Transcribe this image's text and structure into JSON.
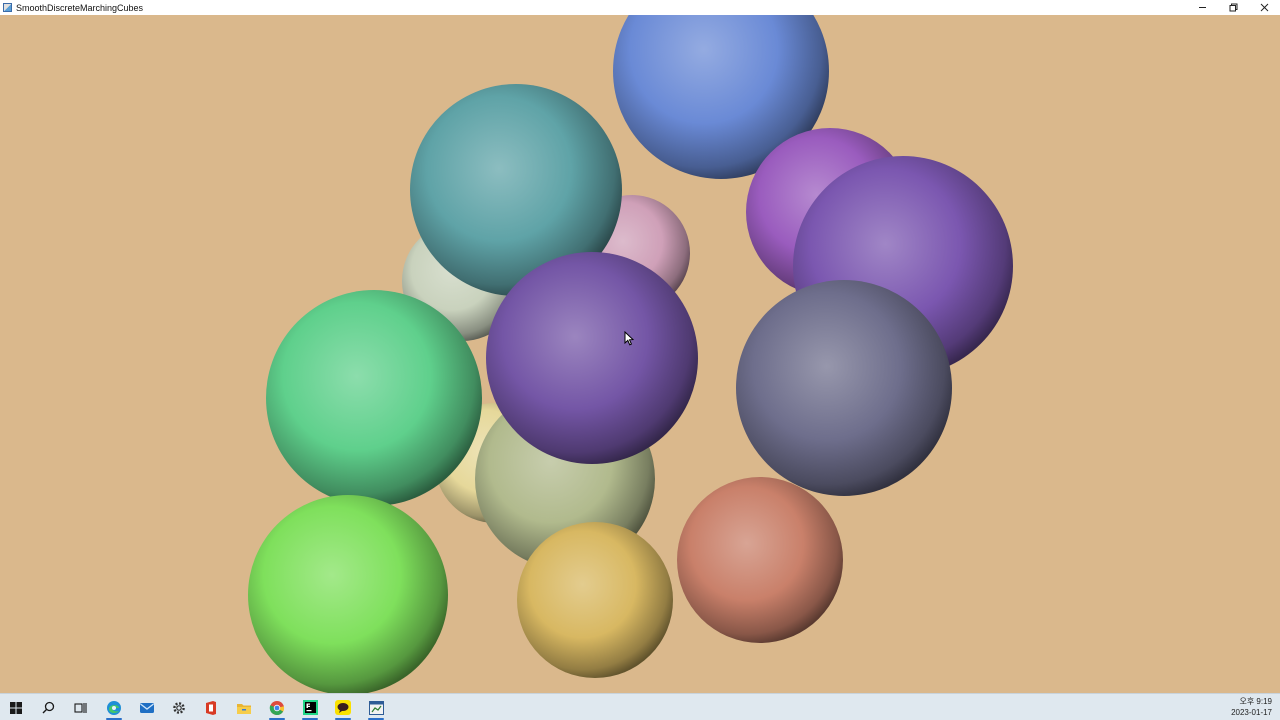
{
  "window": {
    "title": "SmoothDiscreteMarchingCubes",
    "controls": [
      "minimize-icon",
      "restore-icon",
      "close-icon"
    ]
  },
  "scene": {
    "background": "#dab88c",
    "spheres": [
      {
        "name": "blue-sphere",
        "color": "#6a8ad6"
      },
      {
        "name": "teal-sphere",
        "color": "#5fa3a7"
      },
      {
        "name": "pink-sphere",
        "color": "#cfa0b8"
      },
      {
        "name": "pale-sphere",
        "color": "#c9d2bd"
      },
      {
        "name": "purple-front-sphere",
        "color": "#7456a6"
      },
      {
        "name": "magenta-sphere",
        "color": "#9a5cbe"
      },
      {
        "name": "purple-right-sphere",
        "color": "#7b57b0"
      },
      {
        "name": "slate-sphere",
        "color": "#6e6e8c"
      },
      {
        "name": "mint-green-sphere",
        "color": "#5fd08c"
      },
      {
        "name": "pale-yellow-sphere",
        "color": "#e6d89a"
      },
      {
        "name": "khaki-sphere",
        "color": "#b1ba8d"
      },
      {
        "name": "lime-green-sphere",
        "color": "#7fe05c"
      },
      {
        "name": "gold-sphere",
        "color": "#d8b862"
      },
      {
        "name": "salmon-sphere",
        "color": "#c9806a"
      }
    ]
  },
  "taskbar": {
    "icons": [
      "windows-start-icon",
      "search-icon",
      "task-view-icon",
      "edge-browser-icon",
      "mail-icon",
      "settings-icon",
      "office-icon",
      "file-explorer-icon",
      "chrome-icon",
      "pycharm-icon",
      "kakaotalk-icon",
      "marching-cubes-app-icon"
    ],
    "clock": {
      "time": "오후 9:19",
      "date": "2023-01-17"
    }
  }
}
